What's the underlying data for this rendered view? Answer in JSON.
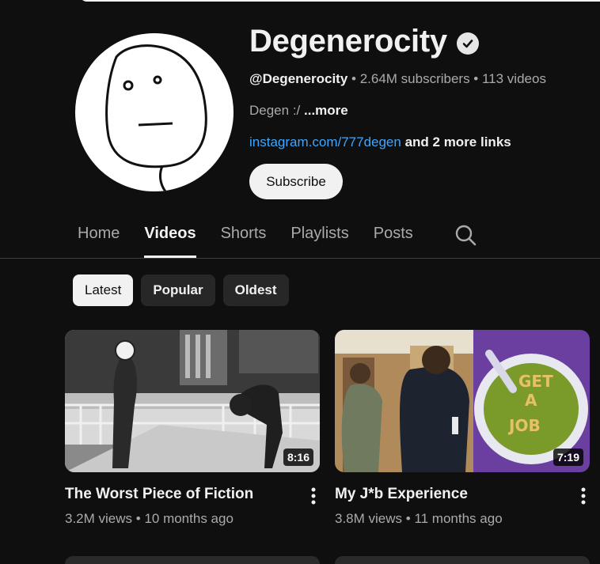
{
  "channel": {
    "name": "Degenerocity",
    "handle": "@Degenerocity",
    "subscribers": "2.64M subscribers",
    "video_count": "113 videos",
    "separator": " • ",
    "description": "Degen :/ ",
    "more_label": "...more",
    "link_text": "instagram.com/777degen",
    "more_links": " and 2 more links",
    "subscribe_label": "Subscribe"
  },
  "tabs": [
    {
      "label": "Home",
      "active": false
    },
    {
      "label": "Videos",
      "active": true
    },
    {
      "label": "Shorts",
      "active": false
    },
    {
      "label": "Playlists",
      "active": false
    },
    {
      "label": "Posts",
      "active": false
    }
  ],
  "chips": [
    {
      "label": "Latest",
      "active": true
    },
    {
      "label": "Popular",
      "active": false
    },
    {
      "label": "Oldest",
      "active": false
    }
  ],
  "videos": [
    {
      "title": "The Worst Piece of Fiction",
      "views": "3.2M views",
      "age": "10 months ago",
      "duration": "8:16"
    },
    {
      "title": "My J*b Experience",
      "views": "3.8M views",
      "age": "11 months ago",
      "duration": "7:19"
    }
  ],
  "icons": {
    "verified": "verified-check-icon",
    "search": "search-icon",
    "menu": "more-vert-icon"
  },
  "colors": {
    "background": "#0f0f0f",
    "link": "#3ea6ff",
    "chip": "#272727",
    "muted_text": "#aaaaaa"
  }
}
